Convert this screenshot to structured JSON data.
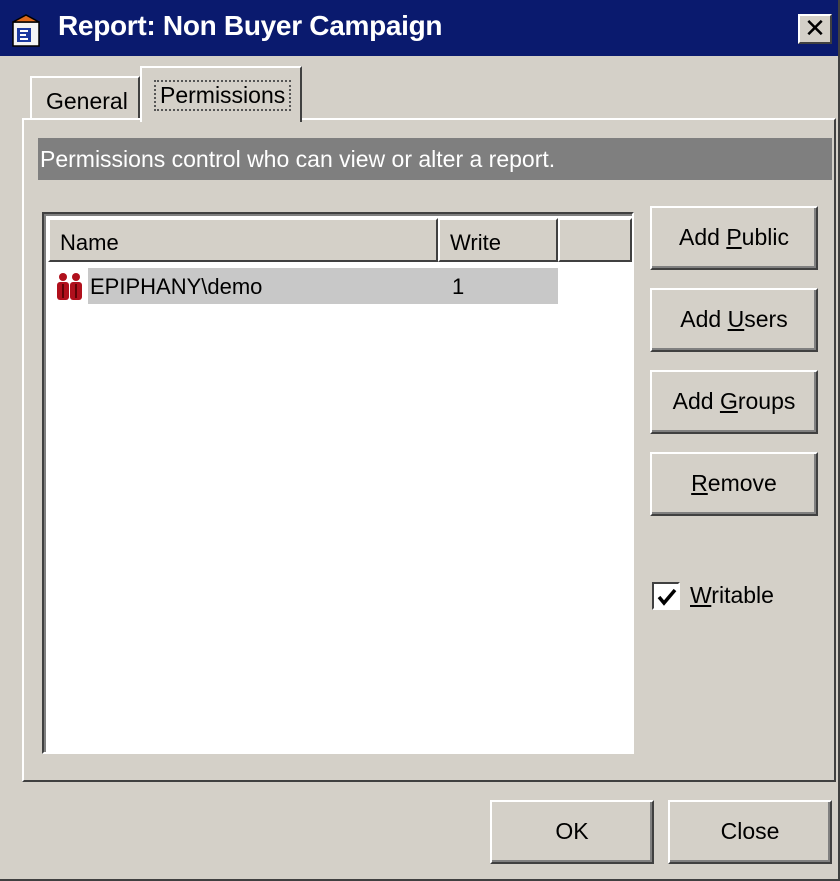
{
  "window": {
    "title": "Report: Non Buyer Campaign",
    "close_glyph": "✕",
    "icon": "report-document-icon"
  },
  "tabs": [
    {
      "label": "General",
      "active": false
    },
    {
      "label": "Permissions",
      "active": true
    }
  ],
  "info_text": "Permissions control who can view or alter a report.",
  "list": {
    "columns": [
      "Name",
      "Write",
      ""
    ],
    "rows": [
      {
        "icon": "user-group-icon",
        "name": "EPIPHANY\\demo",
        "write": "1",
        "selected": true
      }
    ]
  },
  "buttons": {
    "add_public": {
      "before": "Add ",
      "underline": "P",
      "after": "ublic"
    },
    "add_users": {
      "before": "Add ",
      "underline": "U",
      "after": "sers"
    },
    "add_groups": {
      "before": "Add ",
      "underline": "G",
      "after": "roups"
    },
    "remove": {
      "before": "",
      "underline": "R",
      "after": "emove"
    },
    "ok": "OK",
    "close": "Close"
  },
  "writable": {
    "before": "",
    "underline": "W",
    "after": "ritable",
    "checked": true
  },
  "colors": {
    "title_bar": "#0a1a6e",
    "face": "#d4d0c8",
    "info_bar": "#7f7f7f",
    "selection": "#c8c8c8"
  }
}
